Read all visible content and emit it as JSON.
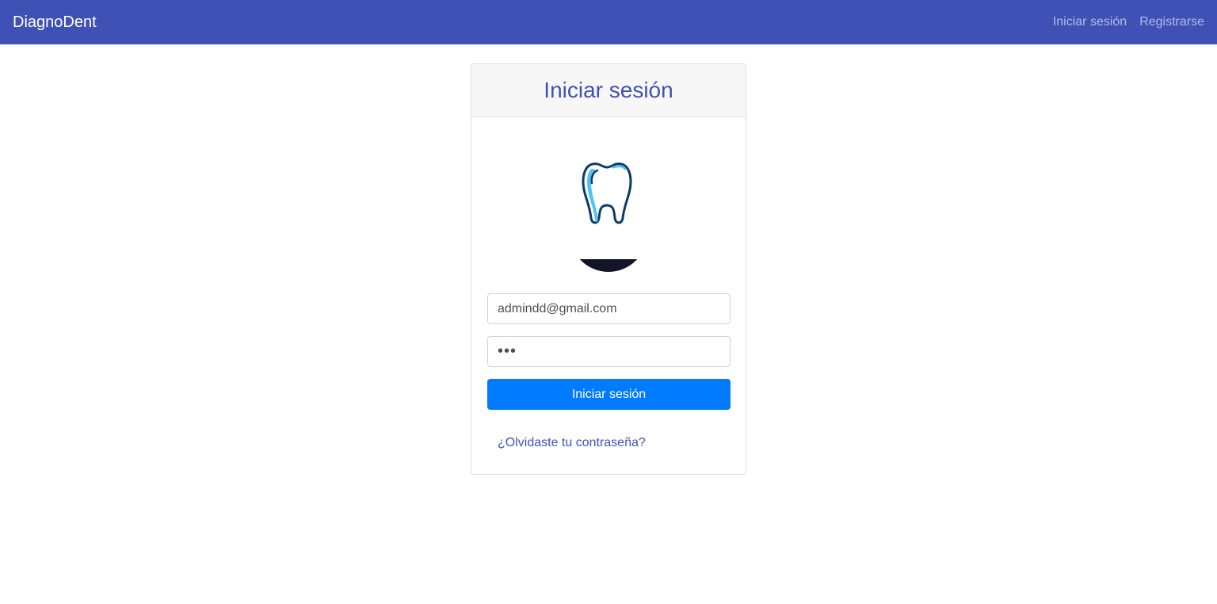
{
  "navbar": {
    "brand": "DiagnoDent",
    "links": [
      "Iniciar sesión",
      "Registrarse"
    ],
    "background": "#3f51b5"
  },
  "card": {
    "title": "Iniciar sesión",
    "logo_icon": "tooth-icon",
    "email_value": "admindd@gmail.com",
    "password_value": "•••",
    "submit_label": "Iniciar sesión",
    "forgot_link": "¿Olvidaste tu contraseña?",
    "button_color": "#007bff"
  }
}
